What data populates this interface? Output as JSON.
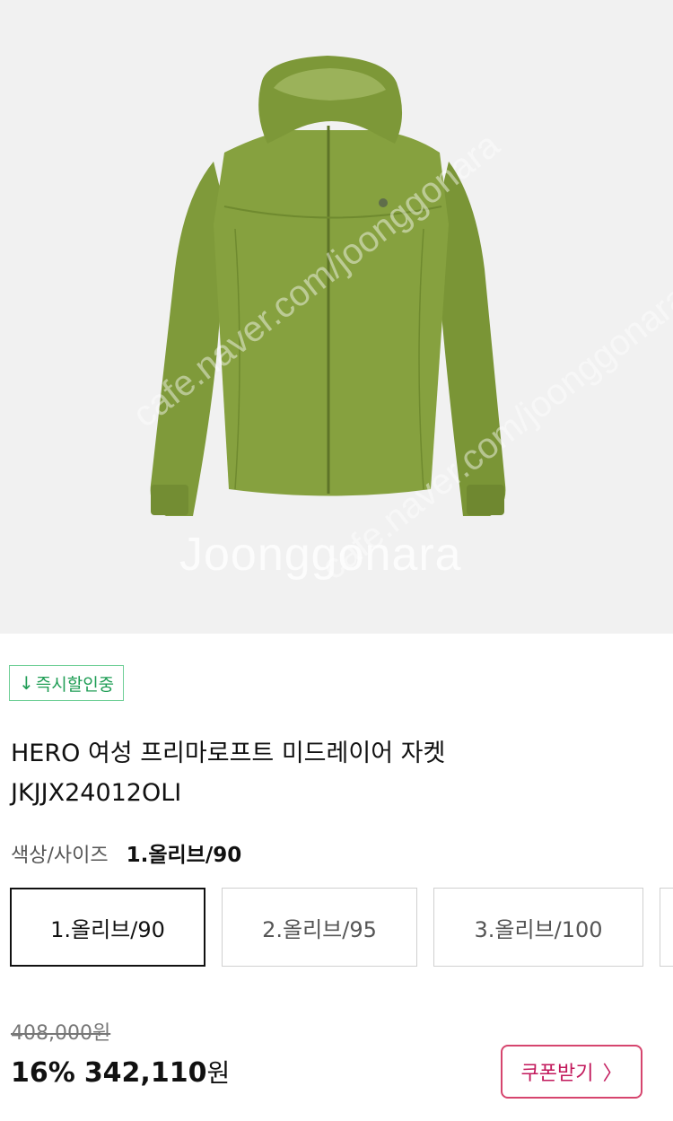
{
  "product_image": {
    "alt": "",
    "watermark_text": "Joonggonara",
    "watermark_url": "cafe.naver.com/joonggonara"
  },
  "badge": {
    "icon": "down-arrow-icon",
    "arrow": "↓",
    "label": "즉시할인중",
    "color": "#1f9d55"
  },
  "product": {
    "title_line1": "HERO 여성 프리마로프트 미드레이어 자켓",
    "title_line2": "JKJJX24012OLI"
  },
  "options": {
    "label": "색상/사이즈",
    "selected_value": "1.올리브/90",
    "chips": [
      {
        "label": "1.올리브/90",
        "selected": true
      },
      {
        "label": "2.올리브/95",
        "selected": false
      },
      {
        "label": "3.올리브/100",
        "selected": false
      }
    ]
  },
  "price": {
    "original": "408,000원",
    "discount": "16%",
    "sale_amount": "342,110",
    "currency": "원"
  },
  "coupon": {
    "label": "쿠폰받기",
    "chevron": "〉",
    "accent": "#d6456e"
  }
}
